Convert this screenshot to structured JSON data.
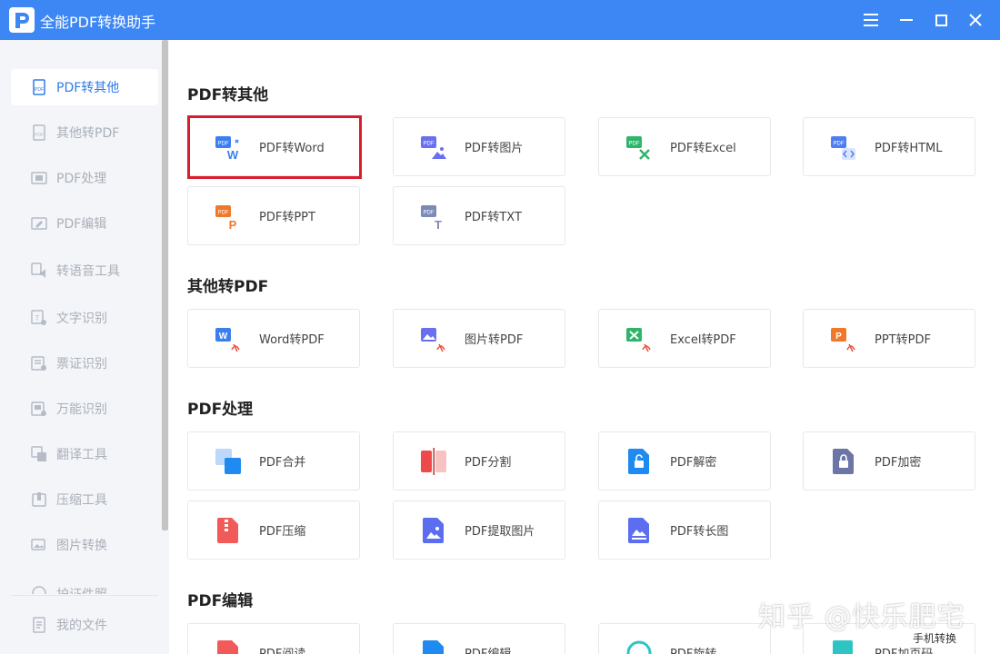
{
  "window": {
    "title": "全能PDF转换助手",
    "accent": "#3d87f5"
  },
  "sidebar": {
    "items": [
      {
        "label": "PDF转其他",
        "icon": "pdf-doc-icon",
        "active": true
      },
      {
        "label": "其他转PDF",
        "icon": "pdf-doc-icon"
      },
      {
        "label": "PDF处理",
        "icon": "pdf-process-icon"
      },
      {
        "label": "PDF编辑",
        "icon": "pdf-edit-icon"
      },
      {
        "label": "转语音工具",
        "icon": "audio-icon"
      },
      {
        "label": "文字识别",
        "icon": "ocr-icon"
      },
      {
        "label": "票证识别",
        "icon": "ticket-icon"
      },
      {
        "label": "万能识别",
        "icon": "scan-icon"
      },
      {
        "label": "翻译工具",
        "icon": "translate-icon"
      },
      {
        "label": "压缩工具",
        "icon": "compress-icon"
      },
      {
        "label": "图片转换",
        "icon": "image-icon"
      },
      {
        "label": "护证件照",
        "icon": "id-photo-icon"
      }
    ],
    "footer": {
      "label": "我的文件",
      "icon": "file-icon"
    }
  },
  "sections": [
    {
      "title": "PDF转其他",
      "cards": [
        {
          "label": "PDF转Word",
          "icon": "pdf-to-word-icon"
        },
        {
          "label": "PDF转图片",
          "icon": "pdf-to-image-icon"
        },
        {
          "label": "PDF转Excel",
          "icon": "pdf-to-excel-icon"
        },
        {
          "label": "PDF转HTML",
          "icon": "pdf-to-html-icon"
        },
        {
          "label": "PDF转PPT",
          "icon": "pdf-to-ppt-icon"
        },
        {
          "label": "PDF转TXT",
          "icon": "pdf-to-txt-icon"
        }
      ]
    },
    {
      "title": "其他转PDF",
      "cards": [
        {
          "label": "Word转PDF",
          "icon": "word-to-pdf-icon"
        },
        {
          "label": "图片转PDF",
          "icon": "image-to-pdf-icon"
        },
        {
          "label": "Excel转PDF",
          "icon": "excel-to-pdf-icon"
        },
        {
          "label": "PPT转PDF",
          "icon": "ppt-to-pdf-icon"
        }
      ]
    },
    {
      "title": "PDF处理",
      "cards": [
        {
          "label": "PDF合并",
          "icon": "merge-icon"
        },
        {
          "label": "PDF分割",
          "icon": "split-icon"
        },
        {
          "label": "PDF解密",
          "icon": "unlock-icon"
        },
        {
          "label": "PDF加密",
          "icon": "lock-icon"
        },
        {
          "label": "PDF压缩",
          "icon": "zip-icon"
        },
        {
          "label": "PDF提取图片",
          "icon": "extract-image-icon"
        },
        {
          "label": "PDF转长图",
          "icon": "long-image-icon"
        }
      ]
    },
    {
      "title": "PDF编辑",
      "cards": [
        {
          "label": "PDF阅读",
          "icon": "read-icon"
        },
        {
          "label": "PDF编辑",
          "icon": "edit-icon"
        },
        {
          "label": "PDF旋转",
          "icon": "rotate-icon"
        },
        {
          "label": "PDF加页码",
          "icon": "page-number-icon"
        }
      ]
    }
  ],
  "watermark": {
    "text": "知乎 @快乐肥宅",
    "sub": "手机转换"
  },
  "colors": {
    "word": "#3a7ff0",
    "image": "#6a6ff0",
    "excel": "#2fb56a",
    "html": "#4f7ef0",
    "ppt": "#f0782a",
    "txt": "#7c8ab8",
    "highlight": "#d81e2c"
  }
}
